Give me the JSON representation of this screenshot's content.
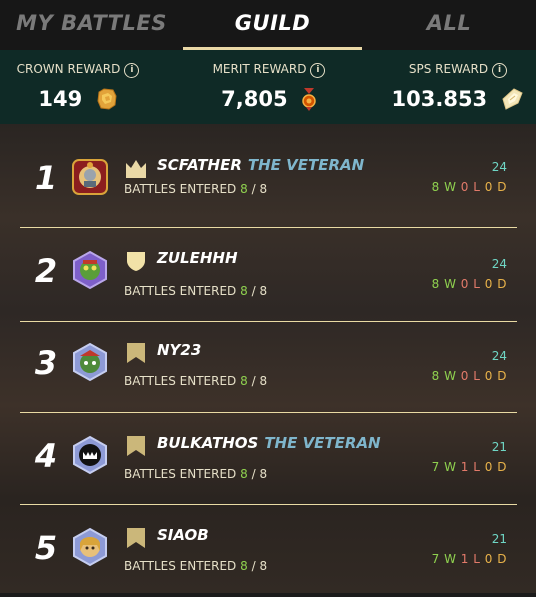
{
  "tabs": [
    {
      "label": "MY BATTLES",
      "active": false
    },
    {
      "label": "GUILD",
      "active": true
    },
    {
      "label": "ALL",
      "active": false
    }
  ],
  "rewards": {
    "crown": {
      "label": "CROWN REWARD",
      "value": "149",
      "icon": "crown-token-icon"
    },
    "merit": {
      "label": "MERIT REWARD",
      "value": "7,805",
      "icon": "merit-medal-icon"
    },
    "sps": {
      "label": "SPS REWARD",
      "value": "103.853",
      "icon": "sps-shard-icon"
    }
  },
  "info_glyph": "i",
  "battles_label": "BATTLES ENTERED",
  "players": [
    {
      "rank": "1",
      "name": "SCFATHER",
      "title": "THE VETERAN",
      "badge": "crown-icon",
      "entered": "8",
      "total": "/ 8",
      "score": "24",
      "w": "8",
      "l": "0",
      "d": "0"
    },
    {
      "rank": "2",
      "name": "ZULEHHH",
      "title": "",
      "badge": "shield-icon",
      "entered": "8",
      "total": "/ 8",
      "score": "24",
      "w": "8",
      "l": "0",
      "d": "0"
    },
    {
      "rank": "3",
      "name": "NY23",
      "title": "",
      "badge": "banner-icon",
      "entered": "8",
      "total": "/ 8",
      "score": "24",
      "w": "8",
      "l": "0",
      "d": "0"
    },
    {
      "rank": "4",
      "name": "BULKATHOS",
      "title": "THE VETERAN",
      "badge": "banner-icon",
      "entered": "8",
      "total": "/ 8",
      "score": "21",
      "w": "7",
      "l": "1",
      "d": "0"
    },
    {
      "rank": "5",
      "name": "SIAOB",
      "title": "",
      "badge": "banner-icon",
      "entered": "8",
      "total": "/ 8",
      "score": "21",
      "w": "7",
      "l": "1",
      "d": "0"
    }
  ],
  "wld_letters": {
    "w": "W",
    "l": "L",
    "d": "D"
  },
  "colors": {
    "accent_gold": "#e9d8a6",
    "win": "#8fd14f",
    "loss": "#e27a6a",
    "draw": "#e8b24a",
    "veteran": "#7fb6cc",
    "rewards_bg": "#0f2a26"
  }
}
